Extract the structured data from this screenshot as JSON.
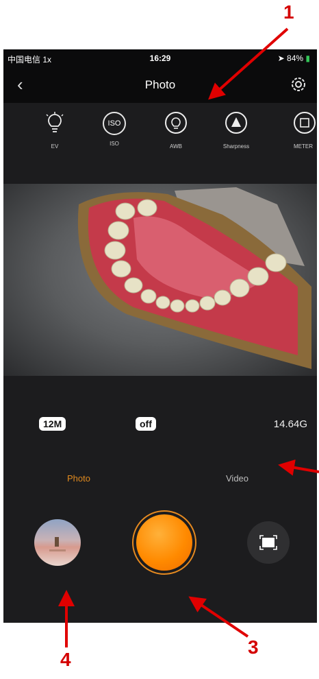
{
  "status_bar": {
    "carrier": "中国电信 1x",
    "time": "16:29",
    "battery": "84%"
  },
  "navbar": {
    "back_icon": "chevron-left-icon",
    "title": "Photo",
    "settings_icon": "gear-icon"
  },
  "toolbar": {
    "items": [
      {
        "label": "EV",
        "icon": "bulb-rays-icon"
      },
      {
        "label": "ISO",
        "icon_text": "ISO"
      },
      {
        "label": "AWB",
        "icon": "bulb-circle-icon"
      },
      {
        "label": "Sharpness",
        "icon": "triangle-circle-icon"
      },
      {
        "label": "METER",
        "icon": "meter-icon"
      }
    ]
  },
  "info": {
    "resolution": "12M",
    "toggle": "off",
    "storage": "14.64G"
  },
  "modes": {
    "photo": "Photo",
    "video": "Video",
    "active_color": "#e08a1e",
    "inactive_color": "#bdbdbd"
  },
  "annotations": [
    "1",
    "3",
    "4"
  ],
  "colors": {
    "accent": "#ff8a00",
    "annotation": "#d40000"
  }
}
